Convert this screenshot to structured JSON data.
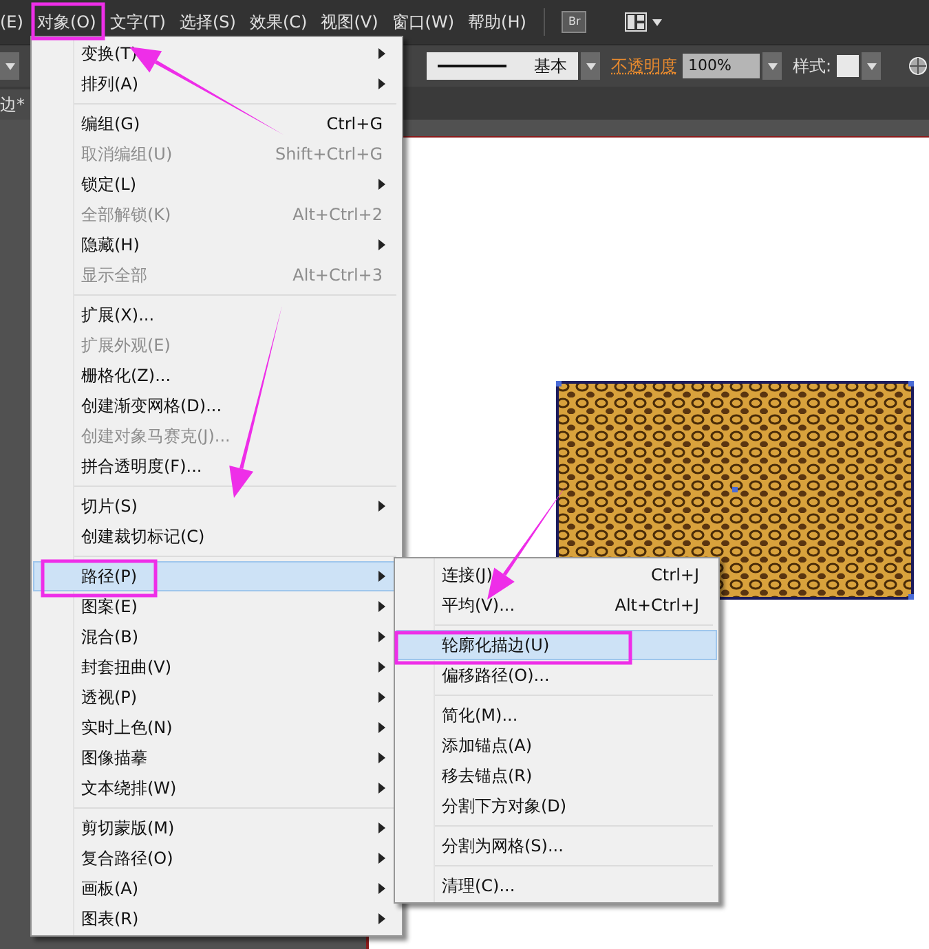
{
  "menu_bar": {
    "items": [
      "(E)",
      "对象(O)",
      "文字(T)",
      "选择(S)",
      "效果(C)",
      "视图(V)",
      "窗口(W)",
      "帮助(H)"
    ],
    "bridge_button": "Br"
  },
  "control_bar": {
    "stroke_profile": "基本",
    "opacity_label": "不透明度",
    "opacity_value": "100%",
    "style_label": "样式:"
  },
  "document_tab": {
    "title": "边*"
  },
  "object_menu": {
    "groups": [
      [
        {
          "label": "变换(T)",
          "disabled": false,
          "submenu": true,
          "selected": false
        },
        {
          "label": "排列(A)",
          "disabled": false,
          "submenu": true,
          "selected": false
        }
      ],
      [
        {
          "label": "编组(G)",
          "shortcut": "Ctrl+G",
          "disabled": false,
          "submenu": false,
          "selected": false
        },
        {
          "label": "取消编组(U)",
          "shortcut": "Shift+Ctrl+G",
          "disabled": true,
          "submenu": false,
          "selected": false
        },
        {
          "label": "锁定(L)",
          "disabled": false,
          "submenu": true,
          "selected": false
        },
        {
          "label": "全部解锁(K)",
          "shortcut": "Alt+Ctrl+2",
          "disabled": true,
          "submenu": false,
          "selected": false
        },
        {
          "label": "隐藏(H)",
          "disabled": false,
          "submenu": true,
          "selected": false
        },
        {
          "label": "显示全部",
          "shortcut": "Alt+Ctrl+3",
          "disabled": true,
          "submenu": false,
          "selected": false
        }
      ],
      [
        {
          "label": "扩展(X)...",
          "disabled": false,
          "submenu": false,
          "selected": false
        },
        {
          "label": "扩展外观(E)",
          "disabled": true,
          "submenu": false,
          "selected": false
        },
        {
          "label": "栅格化(Z)...",
          "disabled": false,
          "submenu": false,
          "selected": false
        },
        {
          "label": "创建渐变网格(D)...",
          "disabled": false,
          "submenu": false,
          "selected": false
        },
        {
          "label": "创建对象马赛克(J)...",
          "disabled": true,
          "submenu": false,
          "selected": false
        },
        {
          "label": "拼合透明度(F)...",
          "disabled": false,
          "submenu": false,
          "selected": false
        }
      ],
      [
        {
          "label": "切片(S)",
          "disabled": false,
          "submenu": true,
          "selected": false
        },
        {
          "label": "创建裁切标记(C)",
          "disabled": false,
          "submenu": false,
          "selected": false
        }
      ],
      [
        {
          "label": "路径(P)",
          "disabled": false,
          "submenu": true,
          "selected": true
        },
        {
          "label": "图案(E)",
          "disabled": false,
          "submenu": true,
          "selected": false
        },
        {
          "label": "混合(B)",
          "disabled": false,
          "submenu": true,
          "selected": false
        },
        {
          "label": "封套扭曲(V)",
          "disabled": false,
          "submenu": true,
          "selected": false
        },
        {
          "label": "透视(P)",
          "disabled": false,
          "submenu": true,
          "selected": false
        },
        {
          "label": "实时上色(N)",
          "disabled": false,
          "submenu": true,
          "selected": false
        },
        {
          "label": "图像描摹",
          "disabled": false,
          "submenu": true,
          "selected": false
        },
        {
          "label": "文本绕排(W)",
          "disabled": false,
          "submenu": true,
          "selected": false
        }
      ],
      [
        {
          "label": "剪切蒙版(M)",
          "disabled": false,
          "submenu": true,
          "selected": false
        },
        {
          "label": "复合路径(O)",
          "disabled": false,
          "submenu": true,
          "selected": false
        },
        {
          "label": "画板(A)",
          "disabled": false,
          "submenu": true,
          "selected": false
        },
        {
          "label": "图表(R)",
          "disabled": false,
          "submenu": true,
          "selected": false
        }
      ]
    ]
  },
  "path_submenu": {
    "groups": [
      [
        {
          "label": "连接(J)",
          "shortcut": "Ctrl+J",
          "disabled": false,
          "submenu": false,
          "selected": false
        },
        {
          "label": "平均(V)...",
          "shortcut": "Alt+Ctrl+J",
          "disabled": false,
          "submenu": false,
          "selected": false
        }
      ],
      [
        {
          "label": "轮廓化描边(U)",
          "disabled": false,
          "submenu": false,
          "selected": true
        },
        {
          "label": "偏移路径(O)...",
          "disabled": false,
          "submenu": false,
          "selected": false
        }
      ],
      [
        {
          "label": "简化(M)...",
          "disabled": false,
          "submenu": false,
          "selected": false
        },
        {
          "label": "添加锚点(A)",
          "disabled": false,
          "submenu": false,
          "selected": false
        },
        {
          "label": "移去锚点(R)",
          "disabled": false,
          "submenu": false,
          "selected": false
        },
        {
          "label": "分割下方对象(D)",
          "disabled": false,
          "submenu": false,
          "selected": false
        }
      ],
      [
        {
          "label": "分割为网格(S)...",
          "disabled": false,
          "submenu": false,
          "selected": false
        }
      ],
      [
        {
          "label": "清理(C)...",
          "disabled": false,
          "submenu": false,
          "selected": false
        }
      ]
    ]
  }
}
